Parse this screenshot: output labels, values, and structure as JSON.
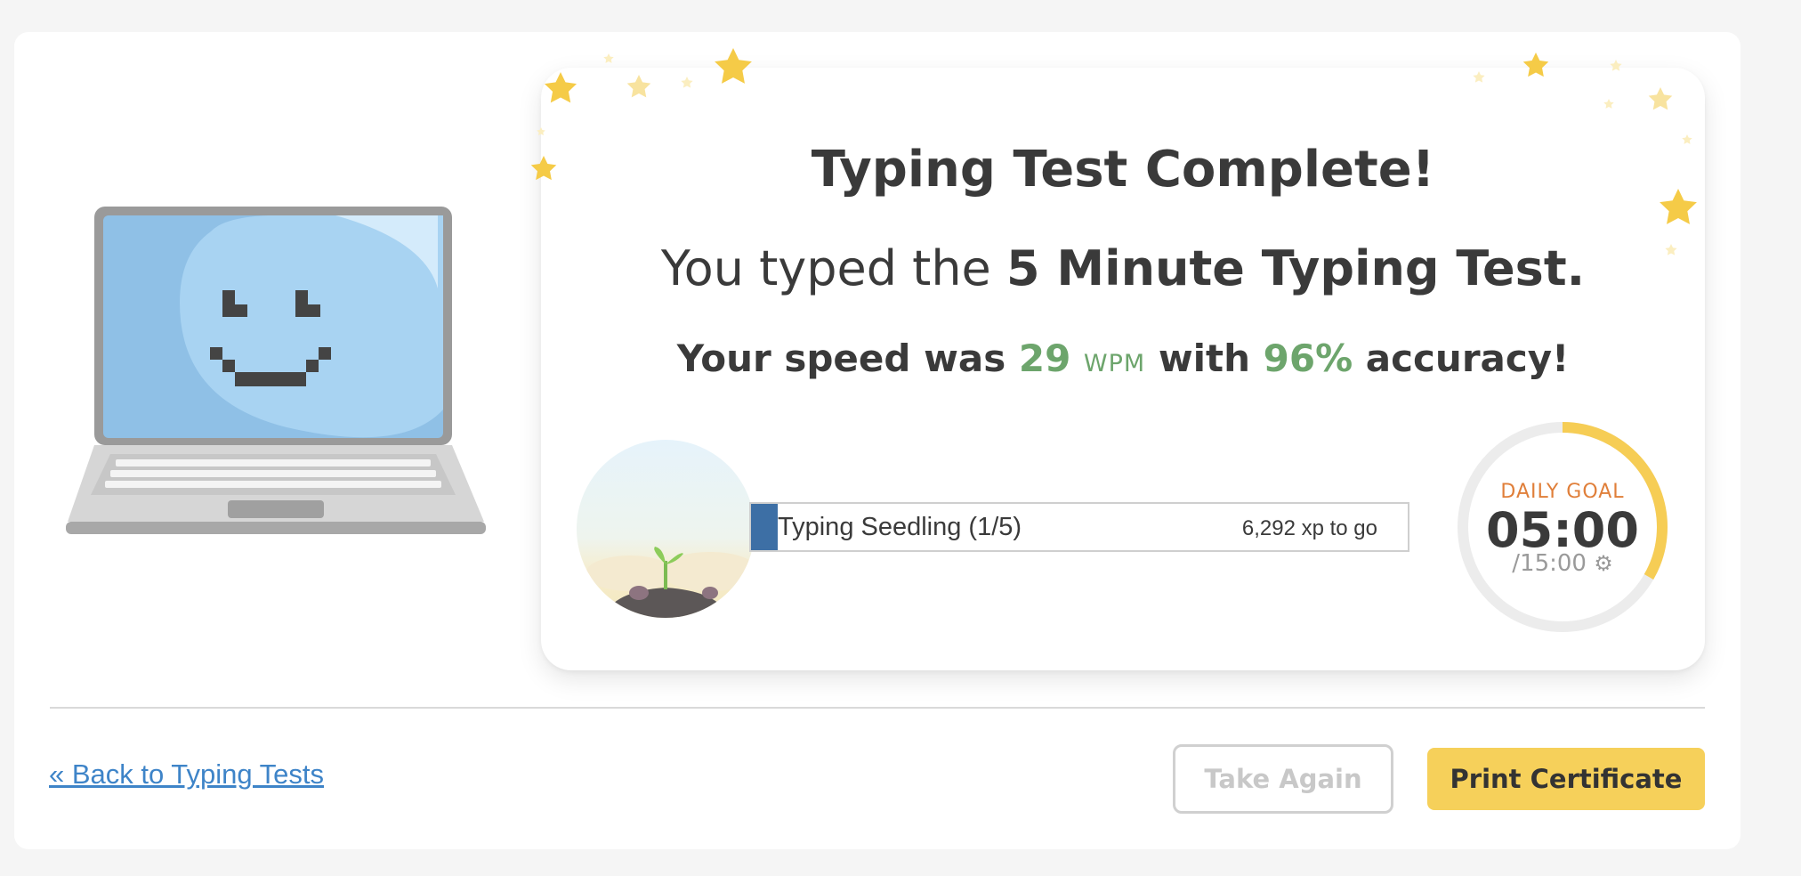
{
  "result": {
    "title": "Typing Test Complete!",
    "subtitle_prefix": "You typed the ",
    "test_name": "5 Minute Typing Test.",
    "speed_prefix": "Your speed was ",
    "wpm_value": "29",
    "wpm_unit": "WPM",
    "speed_middle": " with ",
    "accuracy": "96%",
    "speed_suffix": " accuracy!"
  },
  "level": {
    "name": "Typing Seedling (1/5)",
    "xp_to_go": "6,292 xp to go",
    "progress_fraction": 0.04
  },
  "daily_goal": {
    "label": "DAILY GOAL",
    "time": "05:00",
    "total": "/15:00",
    "progress_fraction": 0.3333
  },
  "footer": {
    "back_link": "« Back to Typing Tests",
    "take_again": "Take Again",
    "print_certificate": "Print Certificate"
  },
  "colors": {
    "accent_green": "#6da56c",
    "goal_orange": "#e07f3a",
    "goal_ring": "#f6cd55",
    "button_yellow": "#f6d05a",
    "link_blue": "#3e84c8",
    "xp_fill": "#3d6fa5"
  },
  "icons": {
    "goal_settings": "gear-icon",
    "mascot": "laptop-smiley-icon",
    "level_badge": "seedling-icon"
  }
}
